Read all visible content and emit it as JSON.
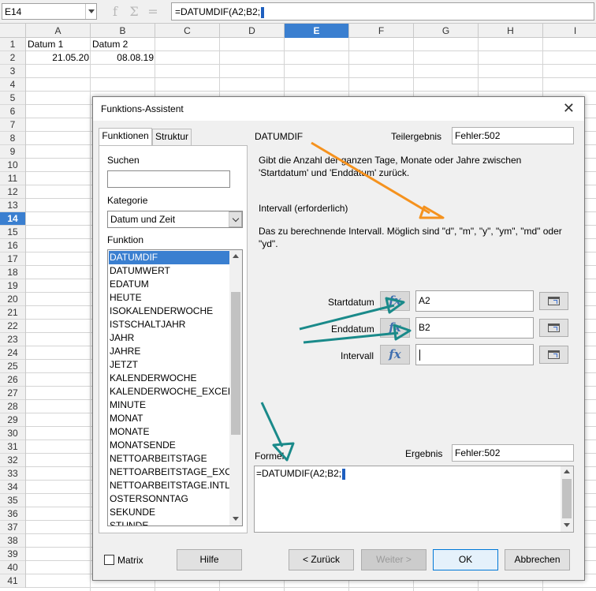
{
  "formula_bar": {
    "name_box": "E14",
    "fx_label": "f",
    "sum_label": "Σ",
    "eq_label": "=",
    "formula": "=DATUMDIF(A2;B2;"
  },
  "sheet": {
    "columns": [
      "A",
      "B",
      "C",
      "D",
      "E",
      "F",
      "G",
      "H",
      "I"
    ],
    "selected_column": "E",
    "rows": [
      "1",
      "2",
      "3",
      "4",
      "5",
      "6",
      "7",
      "8",
      "9",
      "10",
      "11",
      "12",
      "13",
      "14",
      "15",
      "16",
      "17",
      "18",
      "19",
      "20",
      "21",
      "22",
      "23",
      "24",
      "25",
      "26",
      "27",
      "28",
      "29",
      "30",
      "31",
      "32",
      "33",
      "34",
      "35",
      "36",
      "37",
      "38",
      "39",
      "40",
      "41"
    ],
    "selected_row": "14",
    "cells": {
      "a1": "Datum 1",
      "b1": "Datum 2",
      "a2": "21.05.20",
      "b2": "08.08.19"
    }
  },
  "dialog": {
    "title": "Funktions-Assistent",
    "close": "✕",
    "tabs": [
      "Funktionen",
      "Struktur"
    ],
    "search_label": "Suchen",
    "search_value": "",
    "category_label": "Kategorie",
    "category_value": "Datum und Zeit",
    "function_label": "Funktion",
    "functions": [
      "DATUMDIF",
      "DATUMWERT",
      "EDATUM",
      "HEUTE",
      "ISOKALENDERWOCHE",
      "ISTSCHALTJAHR",
      "JAHR",
      "JAHRE",
      "JETZT",
      "KALENDERWOCHE",
      "KALENDERWOCHE_EXCEL2003",
      "MINUTE",
      "MONAT",
      "MONATE",
      "MONATSENDE",
      "NETTOARBEITSTAGE",
      "NETTOARBEITSTAGE_EXCEL2003",
      "NETTOARBEITSTAGE.INTL",
      "OSTERSONNTAG",
      "SEKUNDE",
      "STUNDE"
    ],
    "selected_function": "DATUMDIF",
    "function_name": "DATUMDIF",
    "teilergebnis_label": "Teilergebnis",
    "teilergebnis_value": "Fehler:502",
    "description": "Gibt die Anzahl der ganzen Tage, Monate oder Jahre zwischen 'Startdatum' und 'Enddatum' zurück.",
    "param_title": "Intervall (erforderlich)",
    "param_description": "Das zu berechnende Intervall. Möglich sind \"d\", \"m\", \"y\", \"ym\", \"md\" oder \"yd\".",
    "args": [
      {
        "label": "Startdatum",
        "value": "A2"
      },
      {
        "label": "Enddatum",
        "value": "B2"
      },
      {
        "label": "Intervall",
        "value": ""
      }
    ],
    "fx_icon": "fx",
    "formel_label": "Formel",
    "ergebnis_label": "Ergebnis",
    "ergebnis_value": "Fehler:502",
    "formula_text": "=DATUMDIF(A2;B2;",
    "matrix_label": "Matrix",
    "buttons": {
      "hilfe": "Hilfe",
      "zurueck": "< Zurück",
      "weiter": "Weiter >",
      "ok": "OK",
      "abbrechen": "Abbrechen"
    }
  },
  "colors": {
    "selection": "#3a7fd0",
    "arrow_orange": "#f5921e",
    "arrow_teal": "#1a8a8a"
  }
}
